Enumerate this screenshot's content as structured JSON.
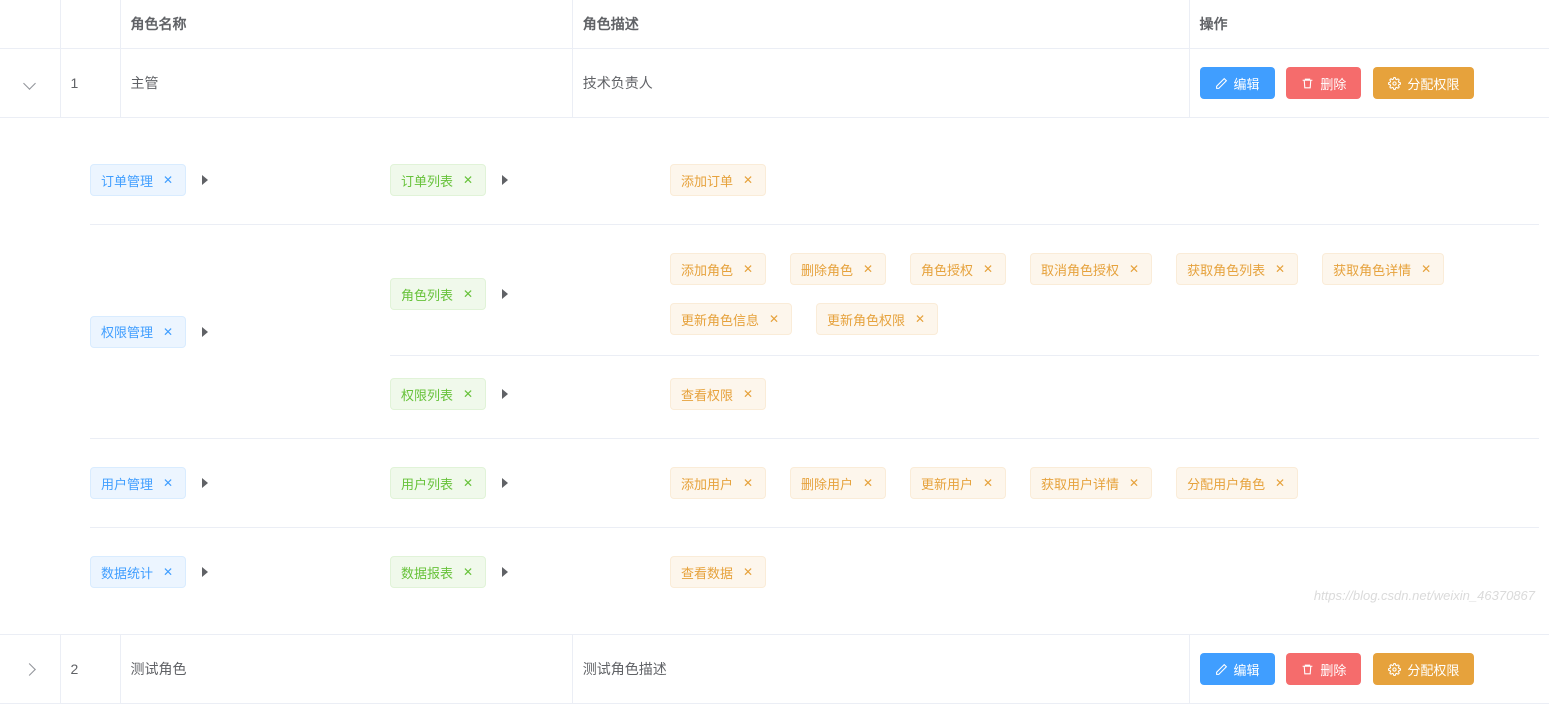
{
  "headers": {
    "name": "角色名称",
    "desc": "角色描述",
    "actions": "操作"
  },
  "buttons": {
    "edit": "编辑",
    "delete": "删除",
    "assign": "分配权限"
  },
  "rows": [
    {
      "index": "1",
      "name": "主管",
      "desc": "技术负责人",
      "expanded": true,
      "perms": [
        {
          "l1": "订单管理",
          "children": [
            {
              "l2": "订单列表",
              "l3": [
                "添加订单"
              ]
            }
          ]
        },
        {
          "l1": "权限管理",
          "children": [
            {
              "l2": "角色列表",
              "l3": [
                "添加角色",
                "删除角色",
                "角色授权",
                "取消角色授权",
                "获取角色列表",
                "获取角色详情",
                "更新角色信息",
                "更新角色权限"
              ]
            },
            {
              "l2": "权限列表",
              "l3": [
                "查看权限"
              ]
            }
          ]
        },
        {
          "l1": "用户管理",
          "children": [
            {
              "l2": "用户列表",
              "l3": [
                "添加用户",
                "删除用户",
                "更新用户",
                "获取用户详情",
                "分配用户角色"
              ]
            }
          ]
        },
        {
          "l1": "数据统计",
          "children": [
            {
              "l2": "数据报表",
              "l3": [
                "查看数据"
              ]
            }
          ]
        }
      ]
    },
    {
      "index": "2",
      "name": "测试角色",
      "desc": "测试角色描述",
      "expanded": false
    }
  ],
  "watermark": "https://blog.csdn.net/weixin_46370867"
}
